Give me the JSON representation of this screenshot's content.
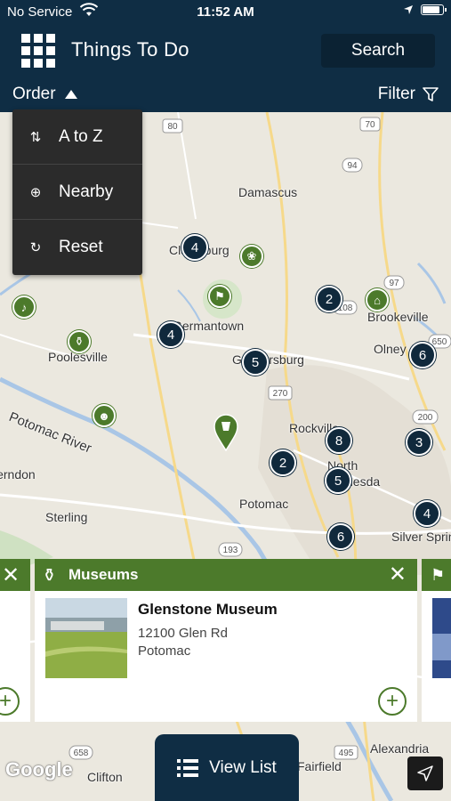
{
  "status_bar": {
    "carrier": "No Service",
    "time": "11:52 AM"
  },
  "header": {
    "title": "Things To Do",
    "search_label": "Search"
  },
  "toolbar": {
    "order_label": "Order",
    "filter_label": "Filter"
  },
  "order_menu": {
    "items": [
      {
        "label": "A to Z",
        "icon": "sort-az-icon"
      },
      {
        "label": "Nearby",
        "icon": "crosshair-icon"
      },
      {
        "label": "Reset",
        "icon": "refresh-icon"
      }
    ]
  },
  "map": {
    "towns": [
      "Damascus",
      "Clarksburg",
      "Germantown",
      "Poolesville",
      "Brookeville",
      "Olney",
      "Gaithersburg",
      "Potomac River",
      "Rockville",
      "North",
      "Bethesda",
      "Potomac",
      "Sterling",
      "Silver Spring",
      "Alexandria",
      "Fairfield",
      "Herndon",
      "Clifton"
    ],
    "highway_shields": [
      "80",
      "70",
      "94",
      "97",
      "108",
      "650",
      "270",
      "200",
      "193",
      "658",
      "495"
    ],
    "clusters": [
      "4",
      "2",
      "4",
      "5",
      "6",
      "8",
      "3",
      "2",
      "5",
      "4",
      "6"
    ],
    "colors": {
      "cluster": "#10293c",
      "poi": "#4c7a2b",
      "header": "#0f2d44"
    }
  },
  "card": {
    "category": "Museums",
    "name": "Glenstone Museum",
    "address": "12100 Glen Rd",
    "city": "Potomac"
  },
  "bottom": {
    "view_list_label": "View List",
    "google_label": "Google"
  }
}
